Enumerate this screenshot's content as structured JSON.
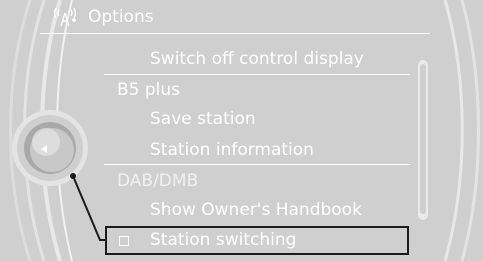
{
  "header": {
    "title": "Options",
    "icon": "broadcast-antenna-icon"
  },
  "menu": {
    "switch_off_display": "Switch off control display",
    "section_b5": "B5 plus",
    "save_station": "Save station",
    "station_information": "Station information",
    "section_dab": "DAB/DMB",
    "show_handbook": "Show Owner's Handbook",
    "station_switching": "Station switching"
  },
  "controller": {
    "icon": "arrow-left-icon"
  },
  "colors": {
    "background": "#cfcfcf",
    "text": "#ffffff",
    "highlight": "#1b1b1b"
  }
}
